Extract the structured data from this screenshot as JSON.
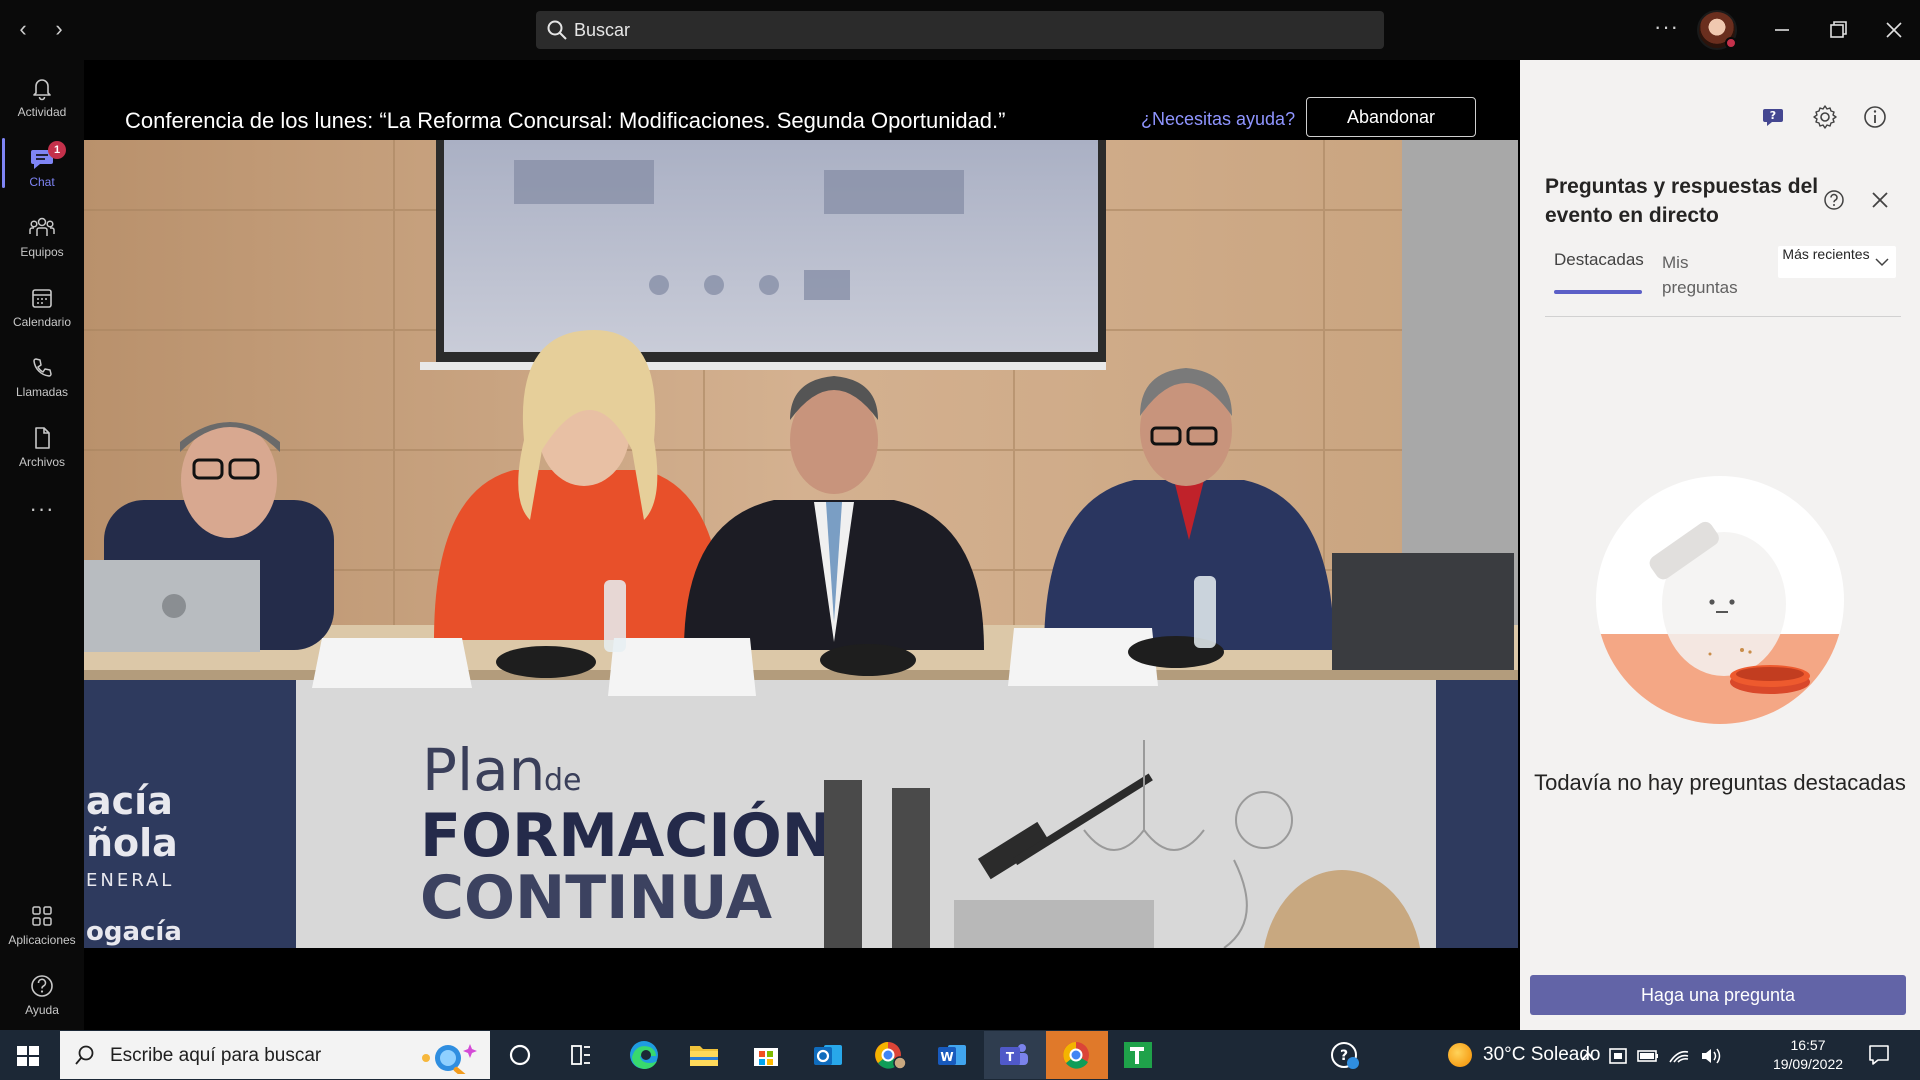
{
  "titlebar": {
    "search_placeholder": "Buscar",
    "more_label": "···"
  },
  "rail": {
    "items": [
      {
        "label": "Actividad",
        "icon": "bell-icon"
      },
      {
        "label": "Chat",
        "icon": "chat-icon",
        "badge": "1",
        "active": true
      },
      {
        "label": "Equipos",
        "icon": "teams-icon"
      },
      {
        "label": "Calendario",
        "icon": "calendar-icon"
      },
      {
        "label": "Llamadas",
        "icon": "phone-icon"
      },
      {
        "label": "Archivos",
        "icon": "file-icon"
      },
      {
        "label": "···",
        "icon": "more-icon"
      },
      {
        "label": "Aplicaciones",
        "icon": "apps-icon"
      },
      {
        "label": "Ayuda",
        "icon": "help-icon"
      }
    ]
  },
  "event": {
    "title": "Conferencia de los lunes: “La Reforma Concursal: Modificaciones. Segunda Oportunidad.”",
    "help_link": "¿Necesitas ayuda?",
    "leave_label": "Abandonar"
  },
  "video": {
    "banner_line1": "Plan",
    "banner_line1b": "de",
    "banner_line2": "FORMACIÓN",
    "banner_line3": "CONTINUA",
    "left_banner_1": "acía",
    "left_banner_2": "ñola",
    "left_banner_3": "ENERAL",
    "left_banner_4": "ogacía"
  },
  "panel": {
    "qa_title": "Preguntas y respuestas del evento en directo",
    "tab_featured": "Destacadas",
    "tab_mine": "Mis preguntas",
    "sort_label": "Más recientes",
    "empty_message": "Todavía no hay preguntas destacadas",
    "ask_button": "Haga una pregunta"
  },
  "taskbar": {
    "search_placeholder": "Escribe aquí para buscar",
    "weather": "30°C  Soleado",
    "time": "16:57",
    "date": "19/09/2022"
  },
  "colors": {
    "accent": "#5b5fc7",
    "ask_button": "#6264a7",
    "badge": "#c4314b",
    "taskbar": "#1c2836"
  }
}
